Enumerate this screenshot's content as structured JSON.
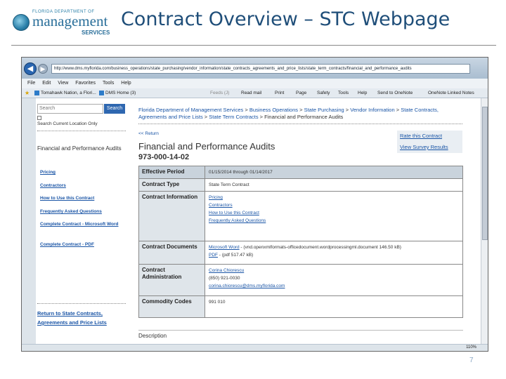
{
  "slide": {
    "title": "Contract Overview – STC Webpage",
    "page_number": "7",
    "logo": {
      "top": "FLORIDA DEPARTMENT OF",
      "main": "management",
      "sub": "SERVICES"
    }
  },
  "browser": {
    "url": "http://www.dms.myflorida.com/business_operations/state_purchasing/vendor_information/state_contracts_agreements_and_price_lists/state_term_contracts/financial_and_performance_audits",
    "menu": [
      "File",
      "Edit",
      "View",
      "Favorites",
      "Tools",
      "Help"
    ],
    "favorites": {
      "tab1": "Tomahawk Nation, a Flori...",
      "tab2": "DMS Home (3)",
      "feeds": "Feeds (J)",
      "read_mail": "Read mail",
      "print": "Print",
      "page": "Page",
      "safety": "Safety",
      "tools": "Tools",
      "help": "Help",
      "onenote": "Send to OneNote",
      "onenote_linked": "OneNote Linked Notes"
    },
    "zoom": "110%"
  },
  "sidebar": {
    "search_placeholder": "Search",
    "search_button": "Search",
    "search_location": "Search Current Location Only",
    "heading": "Financial and Performance Audits",
    "links": [
      "Pricing",
      "Contractors",
      "How to Use this Contract",
      "Frequently Asked Questions",
      "Complete Contract - Microsoft Word",
      "Complete Contract - PDF"
    ],
    "return_link": "Return to State Contracts, Agreements and Price Lists"
  },
  "main": {
    "breadcrumbs": [
      "Florida Department of Management Services",
      "Business Operations",
      "State Purchasing",
      "Vendor Information",
      "State Contracts, Agreements and Price Lists",
      "State Term Contracts",
      "Financial and Performance Audits"
    ],
    "back_link": "<< Return",
    "title": "Financial and Performance Audits",
    "contract_number": "973-000-14-02",
    "rate_link": "Rate this Contract",
    "survey_link": "View Survey Results",
    "table": {
      "effective_period_label": "Effective Period",
      "effective_period_value": "01/15/2014 through 01/14/2017",
      "contract_type_label": "Contract Type",
      "contract_type_value": "State Term Contract",
      "contract_info_label": "Contract Information",
      "contract_info_links": [
        "Pricing",
        "Contractors",
        "How to Use this Contract",
        "Frequently Asked Questions"
      ],
      "contract_docs_label": "Contract Documents",
      "doc_word_link": "Microsoft Word",
      "doc_word_meta": " - (vnd.openxmlformats-officedocument.wordprocessingml.document 146.50 kB)",
      "doc_pdf_link": "PDF",
      "doc_pdf_meta": " - (pdf 517.47 kB)",
      "contract_admin_label": "Contract Administration",
      "admin_name": "Corina Chiorescu",
      "admin_phone": "(850) 921-0030",
      "admin_email": "corina.chiorescu@dms.myflorida.com",
      "commodity_label": "Commodity Codes",
      "commodity_value": "991 010"
    },
    "description_label": "Description"
  }
}
